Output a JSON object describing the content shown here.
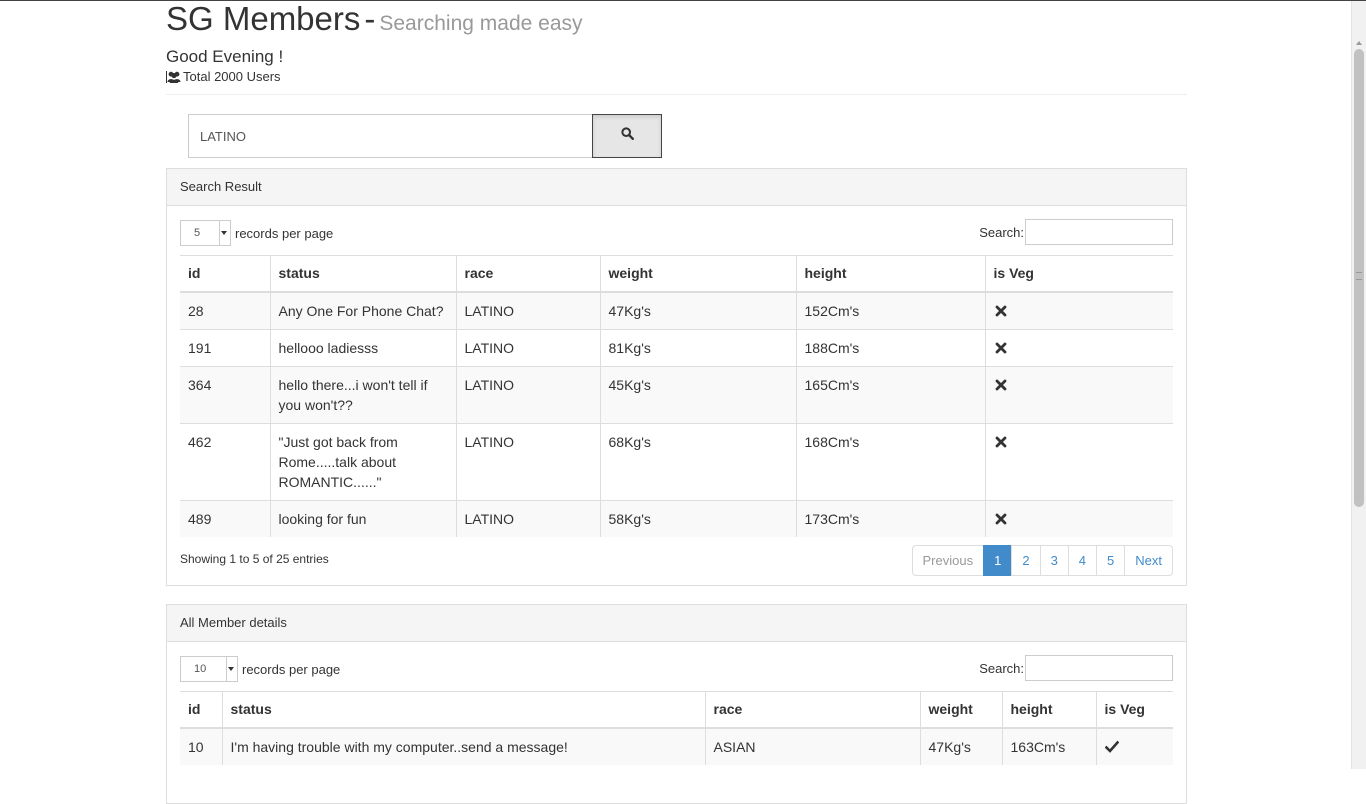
{
  "header": {
    "title": "SG Members",
    "separator": "-",
    "subtitle": "Searching made easy",
    "greeting": "Good Evening !",
    "total_users": "Total 2000 Users"
  },
  "search": {
    "query": "LATINO",
    "button_icon": "search-icon"
  },
  "search_result": {
    "heading": "Search Result",
    "length_value": "5",
    "length_label": "records per page",
    "filter_label": "Search:",
    "columns": [
      "id",
      "status",
      "race",
      "weight",
      "height",
      "is Veg"
    ],
    "rows": [
      {
        "id": "28",
        "status": "Any One For Phone Chat?",
        "race": "LATINO",
        "weight": "47Kg's",
        "height": "152Cm's",
        "veg": "no"
      },
      {
        "id": "191",
        "status": "hellooo ladiesss",
        "race": "LATINO",
        "weight": "81Kg's",
        "height": "188Cm's",
        "veg": "no"
      },
      {
        "id": "364",
        "status": "hello there...i won't tell if you won't??",
        "race": "LATINO",
        "weight": "45Kg's",
        "height": "165Cm's",
        "veg": "no"
      },
      {
        "id": "462",
        "status": "\"Just got back from Rome.....talk about ROMANTIC......\"",
        "race": "LATINO",
        "weight": "68Kg's",
        "height": "168Cm's",
        "veg": "no"
      },
      {
        "id": "489",
        "status": "looking for fun",
        "race": "LATINO",
        "weight": "58Kg's",
        "height": "173Cm's",
        "veg": "no"
      }
    ],
    "info": "Showing 1 to 5 of 25 entries",
    "pagination": {
      "previous": "Previous",
      "pages": [
        "1",
        "2",
        "3",
        "4",
        "5"
      ],
      "active_page": "1",
      "next": "Next"
    }
  },
  "all_members": {
    "heading": "All Member details",
    "length_value": "10",
    "length_label": "records per page",
    "filter_label": "Search:",
    "columns": [
      "id",
      "status",
      "race",
      "weight",
      "height",
      "is Veg"
    ],
    "rows": [
      {
        "id": "10",
        "status": "I'm having trouble with my computer..send a message!",
        "race": "ASIAN",
        "weight": "47Kg's",
        "height": "163Cm's",
        "veg": "yes"
      }
    ]
  },
  "icons": {
    "veg_yes": "check-icon",
    "veg_no": "remove-icon",
    "users": "users-icon"
  },
  "colors": {
    "primary": "#428bca",
    "panel_heading_bg": "#f5f5f5",
    "stripe_bg": "#f9f9f9"
  }
}
